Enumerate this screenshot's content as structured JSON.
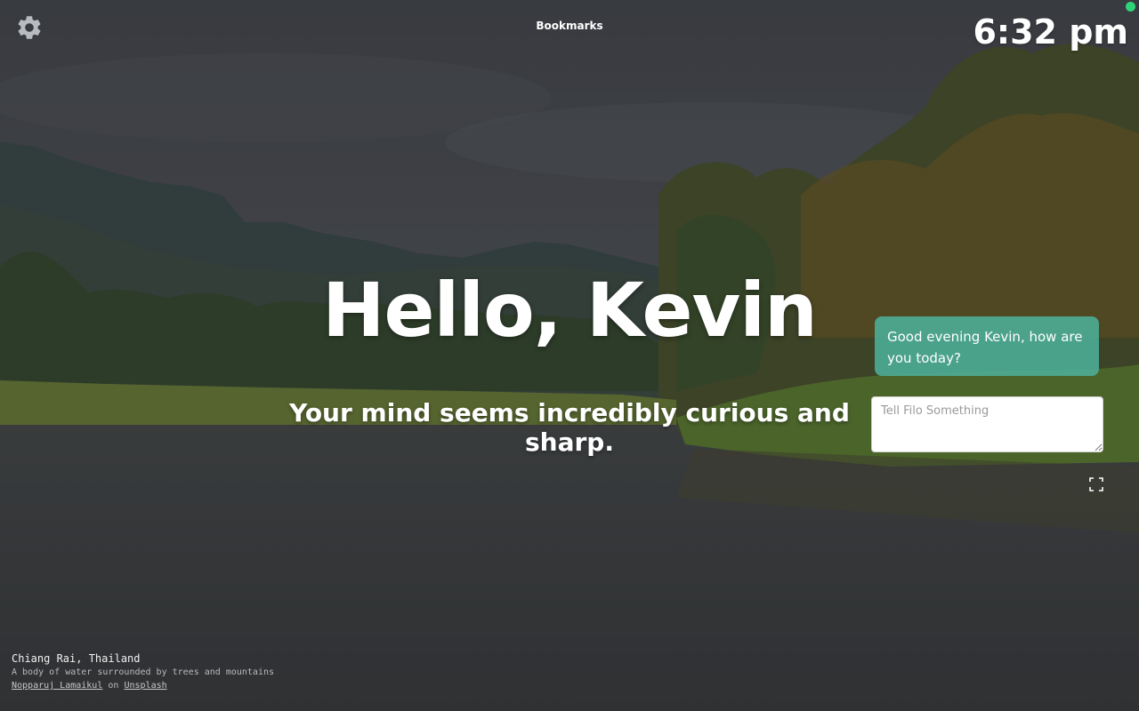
{
  "header": {
    "bookmarks_label": "Bookmarks",
    "time": "6:32 pm"
  },
  "icons": {
    "settings": "gear-icon",
    "fullscreen": "fullscreen-icon",
    "status": "online-status-dot"
  },
  "main": {
    "greeting": "Hello, Kevin",
    "message": "Your mind seems incredibly curious and sharp."
  },
  "chat": {
    "bot_message": "Good evening Kevin, how are you today?",
    "input_placeholder": "Tell Filo Something",
    "input_value": ""
  },
  "photo_credit": {
    "location": "Chiang Rai, Thailand",
    "description": "A body of water surrounded by trees and mountains",
    "photographer": "Nopparuj Lamaikul",
    "separator": "on",
    "platform": "Unsplash"
  },
  "colors": {
    "chat_bubble": "#4daa94",
    "status_dot": "#2ed47a",
    "text": "#ffffff"
  }
}
